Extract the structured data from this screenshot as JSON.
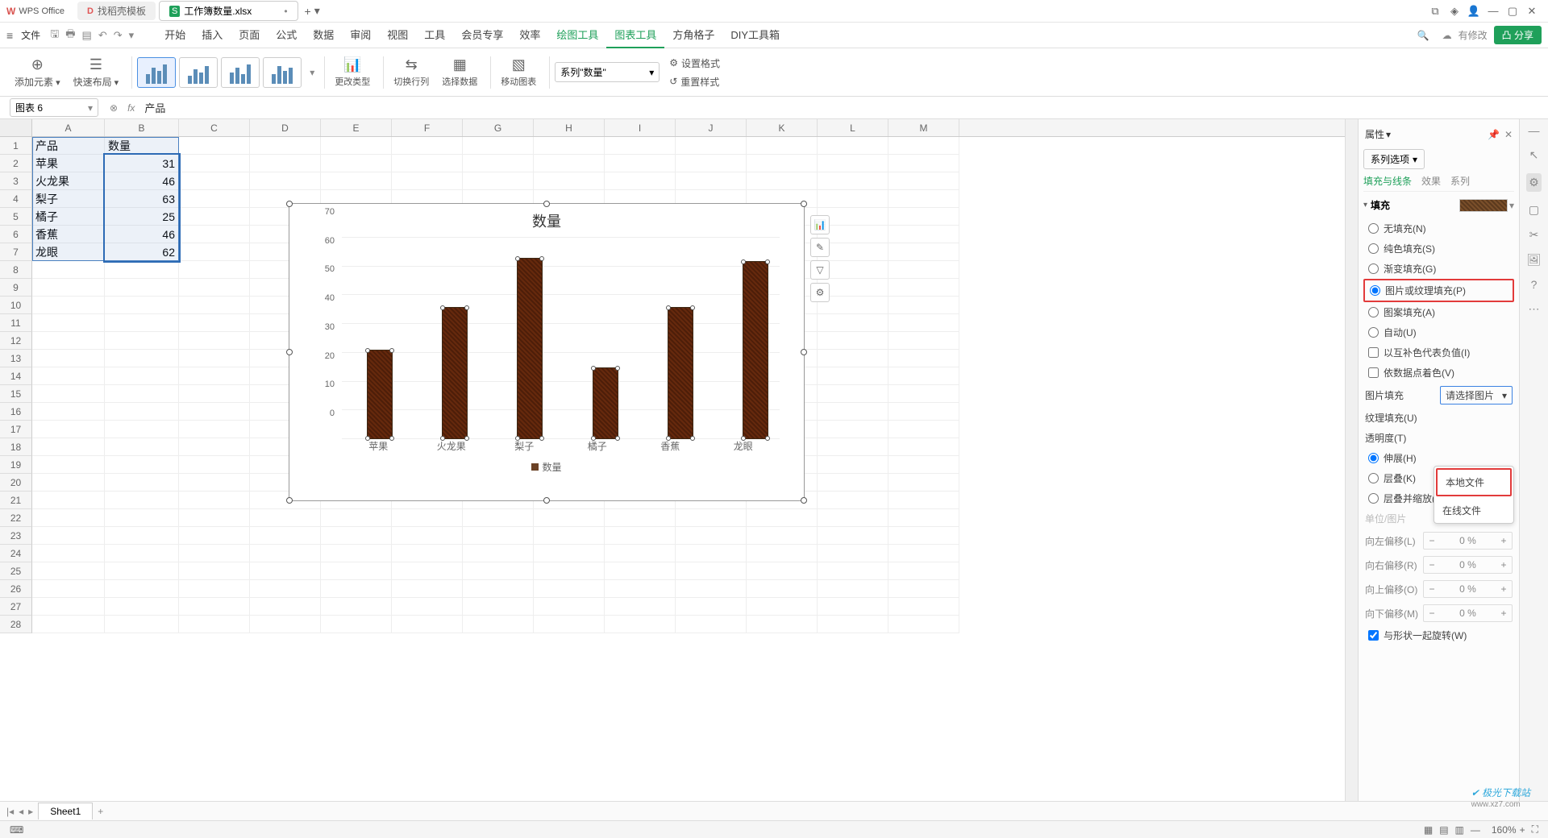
{
  "titlebar": {
    "app": "WPS Office",
    "tabs": [
      {
        "icon": "D",
        "icon_color": "#e05555",
        "label": "找稻壳模板"
      },
      {
        "icon": "S",
        "icon_color": "#1fa05a",
        "label": "工作簿数量.xlsx",
        "active": true
      }
    ],
    "newtab": "+"
  },
  "menubar": {
    "file": "文件",
    "hamburger": "≡",
    "items": [
      "开始",
      "插入",
      "页面",
      "公式",
      "数据",
      "审阅",
      "视图",
      "工具",
      "会员专享",
      "效率",
      "绘图工具",
      "图表工具",
      "方角格子",
      "DIY工具箱"
    ],
    "active": "图表工具",
    "green": "绘图工具",
    "modified": "有修改",
    "share": "分享"
  },
  "ribbon": {
    "add_elem": "添加元素",
    "quick_layout": "快速布局",
    "change_type": "更改类型",
    "swap": "切换行列",
    "select_data": "选择数据",
    "move_chart": "移动图表",
    "series_selector": "系列\"数量\"",
    "set_format": "设置格式",
    "reset_style": "重置样式"
  },
  "formula": {
    "namebox": "图表 6",
    "value": "产品"
  },
  "columns": [
    "A",
    "B",
    "C",
    "D",
    "E",
    "F",
    "G",
    "H",
    "I",
    "J",
    "K",
    "L",
    "M"
  ],
  "rows": 28,
  "table": {
    "headers": [
      "产品",
      "数量"
    ],
    "data": [
      {
        "name": "苹果",
        "qty": "31"
      },
      {
        "name": "火龙果",
        "qty": "46"
      },
      {
        "name": "梨子",
        "qty": "63"
      },
      {
        "name": "橘子",
        "qty": "25"
      },
      {
        "name": "香蕉",
        "qty": "46"
      },
      {
        "name": "龙眼",
        "qty": "62"
      }
    ]
  },
  "chart": {
    "title": "数量",
    "legend": "数量",
    "y_ticks": [
      0,
      10,
      20,
      30,
      40,
      50,
      60,
      70
    ],
    "y_max": 70
  },
  "chart_data": {
    "type": "bar",
    "title": "数量",
    "categories": [
      "苹果",
      "火龙果",
      "梨子",
      "橘子",
      "香蕉",
      "龙眼"
    ],
    "values": [
      31,
      46,
      63,
      25,
      46,
      62
    ],
    "ylabel": "",
    "xlabel": "",
    "ylim": [
      0,
      70
    ]
  },
  "prop": {
    "title": "属性",
    "series_option": "系列选项",
    "tabs": [
      "填充与线条",
      "效果",
      "系列"
    ],
    "active_tab": "填充与线条",
    "fill_section": "填充",
    "fill_opts": [
      "无填充(N)",
      "纯色填充(S)",
      "渐变填充(G)",
      "图片或纹理填充(P)",
      "图案填充(A)",
      "自动(U)"
    ],
    "fill_selected": "图片或纹理填充(P)",
    "checks": [
      "以互补色代表负值(I)",
      "依数据点着色(V)"
    ],
    "pic_fill": "图片填充",
    "pic_fill_val": "请选择图片",
    "tex_fill": "纹理填充(U)",
    "opacity": "透明度(T)",
    "layout_opts": [
      "伸展(H)",
      "层叠(K)",
      "层叠并缩放(W)"
    ],
    "layout_selected": "伸展(H)",
    "unit": "单位/图片",
    "offsets": [
      {
        "k": "向左偏移(L)",
        "v": "0 %"
      },
      {
        "k": "向右偏移(R)",
        "v": "0 %"
      },
      {
        "k": "向上偏移(O)",
        "v": "0 %"
      },
      {
        "k": "向下偏移(M)",
        "v": "0 %"
      }
    ],
    "rotate": "与形状一起旋转(W)",
    "dropdown": [
      "本地文件",
      "在线文件"
    ]
  },
  "sheet": {
    "name": "Sheet1"
  },
  "status": {
    "zoom": "160%"
  },
  "watermark": {
    "main": "极光下载站",
    "sub": "www.xz7.com"
  }
}
